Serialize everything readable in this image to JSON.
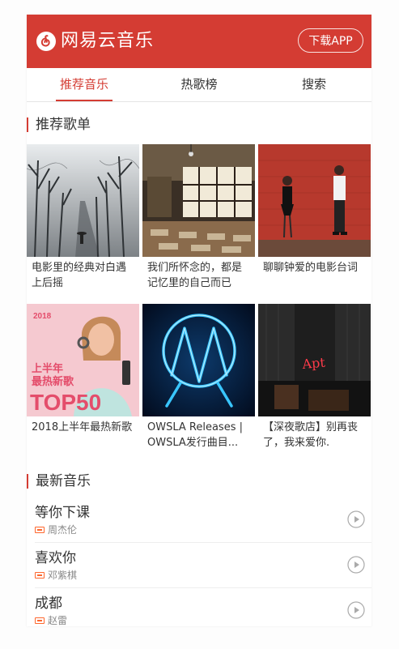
{
  "header": {
    "brand": "网易云音乐",
    "download_label": "下载APP"
  },
  "tabs": [
    {
      "label": "推荐音乐",
      "active": true
    },
    {
      "label": "热歌榜",
      "active": false
    },
    {
      "label": "搜索",
      "active": false
    }
  ],
  "recommend": {
    "title": "推荐歌单",
    "playlists": [
      {
        "title": "电影里的经典对白遇上后摇"
      },
      {
        "title": "我们所怀念的，都是记忆里的自己而已"
      },
      {
        "title": "聊聊钟爱的电影台词"
      },
      {
        "title": "2018上半年最热新歌",
        "cover_text": [
          "2018",
          "上半年",
          "最热新歌",
          "TOP50"
        ]
      },
      {
        "title": "OWSLA Releases | OWSLA发行曲目..."
      },
      {
        "title": "【深夜歌店】别再丧了，我来爱你.",
        "cover_text": [
          "Apt"
        ]
      }
    ]
  },
  "newest": {
    "title": "最新音乐",
    "songs": [
      {
        "name": "等你下课",
        "artist": "周杰伦"
      },
      {
        "name": "喜欢你",
        "artist": "邓紫棋"
      },
      {
        "name": "成都",
        "artist": "赵雷"
      }
    ]
  },
  "colors": {
    "brand_red": "#d43c33",
    "sq_orange": "#fe672e"
  },
  "icons": {
    "logo": "netease-music-logo-icon",
    "sq": "sq-quality-icon",
    "play": "play-circle-icon"
  }
}
